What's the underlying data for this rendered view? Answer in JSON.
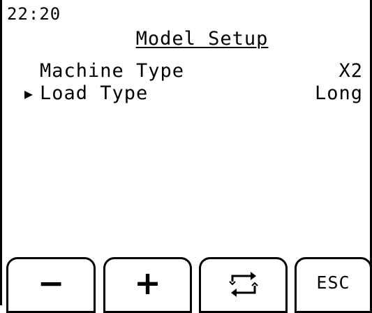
{
  "status": {
    "time": "22:20"
  },
  "screen": {
    "title": "Model Setup",
    "selection_marker": "▶",
    "rows": [
      {
        "label": "Machine Type",
        "value": "X2",
        "selected": false
      },
      {
        "label": "Load Type",
        "value": "Long",
        "selected": true
      }
    ]
  },
  "softkeys": {
    "minus_label": "−",
    "plus_label": "+",
    "toggle_icon": "swap-arrows-icon",
    "esc_label": "ESC"
  }
}
